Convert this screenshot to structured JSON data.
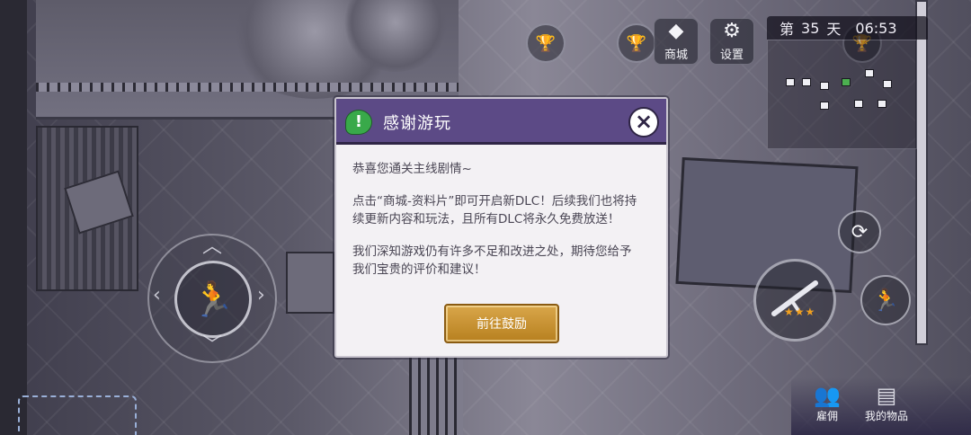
{
  "hud": {
    "shop_label": "商城",
    "settings_label": "设置",
    "day_prefix": "第",
    "day_number": "35",
    "day_suffix": "天",
    "clock": "06:53",
    "rarity_stars": "★★★",
    "bottom_hire_label": "雇佣",
    "bottom_items_label": "我的物品"
  },
  "dialog": {
    "title": "感谢游玩",
    "paragraph1": "恭喜您通关主线剧情~",
    "paragraph2": "点击“商城-资料片”即可开启新DLC！后续我们也将持续更新内容和玩法，且所有DLC将永久免费放送！",
    "paragraph3": "我们深知游戏仍有许多不足和改进之处，期待您给予我们宝贵的评价和建议！",
    "button_label": "前往鼓励"
  },
  "icons": {
    "header": "chat-exclamation-icon",
    "close": "close-icon",
    "shop": "diamond-icon",
    "settings": "gear-icon",
    "trophy": "trophy-icon",
    "run": "run-icon",
    "refresh": "refresh-icon",
    "hire": "people-icon",
    "items": "chest-icon"
  },
  "colors": {
    "dialog_header": "#5c4a86",
    "confirm_button": "#c8922f",
    "header_icon": "#39a94a"
  }
}
